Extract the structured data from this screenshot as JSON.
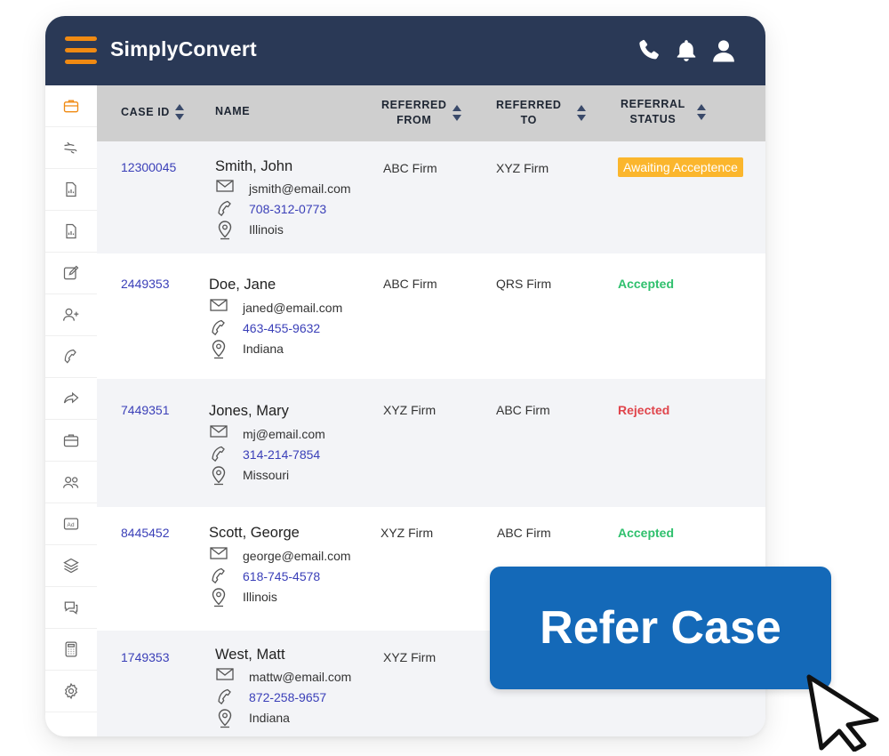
{
  "app": {
    "title": "SimplyConvert"
  },
  "header_icons": [
    "phone-icon",
    "bell-icon",
    "user-icon"
  ],
  "sidebar": {
    "items": [
      "briefcase-icon",
      "hand-icon",
      "document-icon",
      "document-icon",
      "edit-icon",
      "add-user-icon",
      "phone-icon",
      "share-icon",
      "briefcase-icon",
      "users-icon",
      "ad-icon",
      "layers-icon",
      "chat-icon",
      "calculator-icon",
      "gear-icon"
    ],
    "active_index": 0
  },
  "table": {
    "headers": {
      "case_id": "CASE ID",
      "name": "NAME",
      "referred_from_1": "REFERRED",
      "referred_from_2": "FROM",
      "referred_to_1": "REFERRED",
      "referred_to_2": "TO",
      "status_1": "REFERRAL",
      "status_2": "STATUS"
    },
    "rows": [
      {
        "case_id": "12300045",
        "name": "Smith, John",
        "email": "jsmith@email.com",
        "phone": "708-312-0773",
        "location": "Illinois",
        "from": "ABC Firm",
        "to": "XYZ Firm",
        "status": "Awaiting Acceptence"
      },
      {
        "case_id": "2449353",
        "name": "Doe, Jane",
        "email": "janed@email.com",
        "phone": "463-455-9632",
        "location": "Indiana",
        "from": "ABC Firm",
        "to": "QRS Firm",
        "status": "Accepted"
      },
      {
        "case_id": "7449351",
        "name": "Jones, Mary",
        "email": "mj@email.com",
        "phone": "314-214-7854",
        "location": "Missouri",
        "from": "XYZ Firm",
        "to": "ABC Firm",
        "status": "Rejected"
      },
      {
        "case_id": "8445452",
        "name": "Scott, George",
        "email": "george@email.com",
        "phone": "618-745-4578",
        "location": "Illinois",
        "from": "XYZ Firm",
        "to": "ABC Firm",
        "status": "Accepted"
      },
      {
        "case_id": "1749353",
        "name": "West, Matt",
        "email": "mattw@email.com",
        "phone": "872-258-9657",
        "location": "Indiana",
        "from": "XYZ Firm",
        "to": "",
        "status": ""
      }
    ]
  },
  "cta": {
    "label": "Refer Case"
  },
  "colors": {
    "header_bg": "#2a3956",
    "menu_accent": "#f08a12",
    "link": "#3a3fb8",
    "accepted": "#2fc06d",
    "rejected": "#e0454c",
    "awaiting": "#fbb62d",
    "cta": "#1469b8"
  }
}
